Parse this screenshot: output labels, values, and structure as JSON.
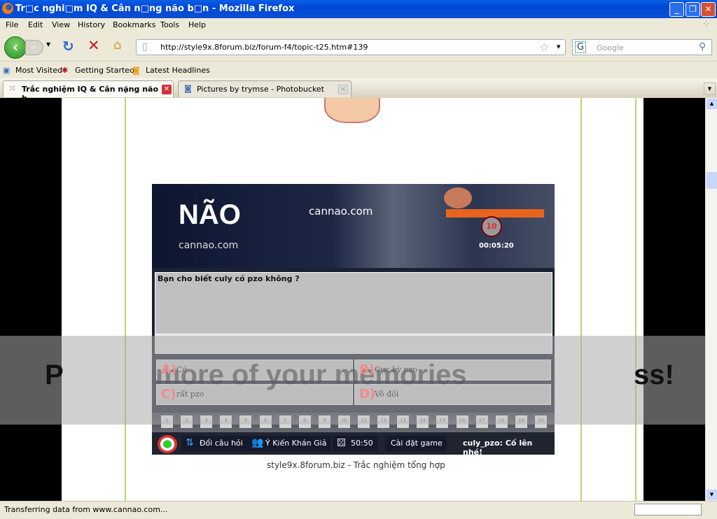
{
  "window": {
    "title": "Tr□c nghi□m IQ & Cân n□ng não b□n - Mozilla Firefox"
  },
  "menu": [
    "File",
    "Edit",
    "View",
    "History",
    "Bookmarks",
    "Tools",
    "Help"
  ],
  "nav": {
    "url": "http://style9x.8forum.biz/forum-f4/topic-t25.htm#139",
    "search_placeholder": "Google",
    "search_engine": "G"
  },
  "bookmarks": [
    "Most Visited",
    "Getting Started",
    "Latest Headlines"
  ],
  "tabs": [
    {
      "label": "Trắc nghiệm IQ & Cân nặng não b...",
      "active": true
    },
    {
      "label": "Pictures by trymse - Photobucket",
      "active": false
    }
  ],
  "game": {
    "banner": {
      "logo": "NÃO",
      "site1": "cannao.com",
      "site2": "cannao.com",
      "question_number": "10",
      "timer": "00:05:20"
    },
    "question": "Bạn cho biết culy có pzo không ?",
    "answers": [
      {
        "letter": "A)",
        "text": "Có"
      },
      {
        "letter": "B)",
        "text": "Cực kỳ pzo"
      },
      {
        "letter": "C)",
        "text": "rất pzo"
      },
      {
        "letter": "D)",
        "text": "Vô đối"
      }
    ],
    "numbers": [
      "1",
      "2",
      "3",
      "4",
      "5",
      "6",
      "7",
      "8",
      "9",
      "10",
      "11",
      "12",
      "13",
      "14",
      "15",
      "16",
      "17",
      "18",
      "19",
      "20"
    ],
    "lifelines": {
      "change": "Đổi câu hỏi",
      "audience": "Ý Kiến Khán Giả",
      "fifty": "50:50",
      "settings": "Cài đặt game"
    },
    "message": "culy_pzo: Cố lên nhé!"
  },
  "caption": "style9x.8forum.biz - Trắc nghiệm tổng hợp",
  "watermark": {
    "left": "P",
    "middle": "more of your memories",
    "right": "ss!"
  },
  "status": "Transferring data from www.cannao.com..."
}
